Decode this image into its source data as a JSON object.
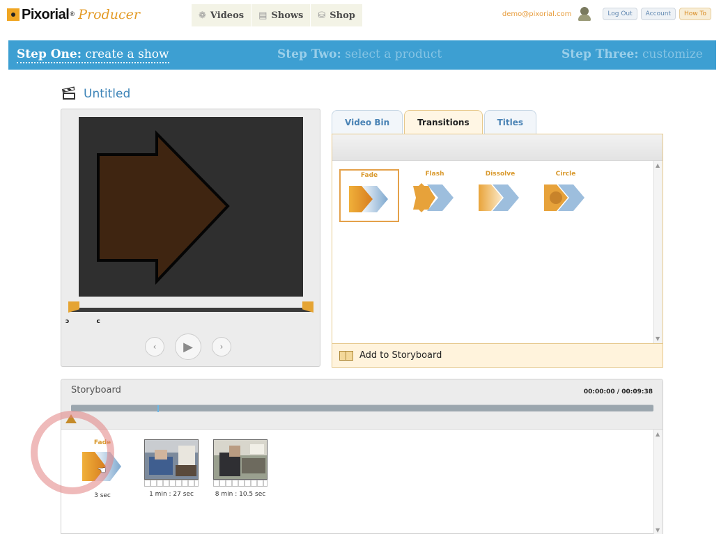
{
  "brand": {
    "name": "Pixorial",
    "reg": "®",
    "product": "Producer"
  },
  "nav": {
    "videos": "Videos",
    "shows": "Shows",
    "shop": "Shop"
  },
  "user": {
    "email": "demo@pixorial.com",
    "logout": "Log Out",
    "account": "Account",
    "howto": "How To"
  },
  "steps": {
    "one_label": "Step One:",
    "one_text": "create a show",
    "two_label": "Step Two:",
    "two_text": "select a product",
    "three_label": "Step Three:",
    "three_text": "customize"
  },
  "show": {
    "title": "Untitled"
  },
  "preview": {
    "marks": "ɔ c"
  },
  "tabs": {
    "video_bin": "Video Bin",
    "transitions": "Transitions",
    "titles": "Titles",
    "active": "Transitions"
  },
  "transitions": [
    {
      "label": "Fade",
      "selected": true
    },
    {
      "label": "Flash",
      "selected": false
    },
    {
      "label": "Dissolve",
      "selected": false
    },
    {
      "label": "Circle",
      "selected": false
    }
  ],
  "add_storyboard": "Add to Storyboard",
  "storyboard": {
    "title": "Storyboard",
    "time": "00:00:00 / 00:09:38",
    "transition": {
      "label": "Fade",
      "duration": "3 sec"
    },
    "clips": [
      {
        "duration": "1 min : 27 sec"
      },
      {
        "duration": "8 min : 10.5 sec"
      }
    ]
  },
  "colors": {
    "accent_orange": "#e39a25",
    "steps_blue": "#3d9fd2",
    "link_blue": "#3d84b8"
  }
}
